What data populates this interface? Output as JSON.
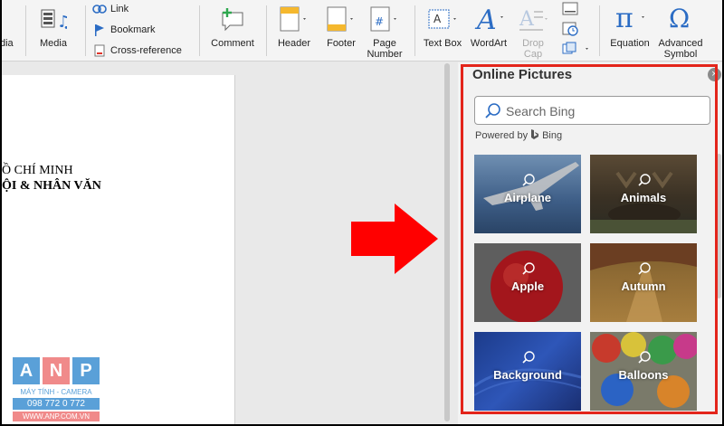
{
  "ribbon": {
    "media_partial_label": "dia",
    "media_label": "Media",
    "link_label": "Link",
    "bookmark_label": "Bookmark",
    "crossref_label": "Cross-reference",
    "comment_label": "Comment",
    "header_label": "Header",
    "footer_label": "Footer",
    "page_number_label_1": "Page",
    "page_number_label_2": "Number",
    "textbox_label": "Text Box",
    "wordart_label": "WordArt",
    "dropcap_label_1": "Drop",
    "dropcap_label_2": "Cap",
    "equation_label": "Equation",
    "advanced_symbol_label_1": "Advanced",
    "advanced_symbol_label_2": "Symbol"
  },
  "document": {
    "line1": "Ồ CHÍ MINH",
    "line2": "ỘI & NHÂN VĂN",
    "logo_letters": [
      "A",
      "N",
      "P"
    ],
    "logo_line1": "MÁY TÍNH - CAMERA",
    "logo_line2": "098 772 0 772",
    "logo_line3": "WWW.ANP.COM.VN"
  },
  "pane": {
    "title": "Online Pictures",
    "search_placeholder": "Search Bing",
    "powered_by": "Powered by",
    "bing": "Bing",
    "categories": [
      "Airplane",
      "Animals",
      "Apple",
      "Autumn",
      "Background",
      "Balloons"
    ]
  },
  "colors": {
    "highlight_border": "#e3251b",
    "arrow": "#ff0000",
    "accent_blue": "#2b6cc4"
  }
}
